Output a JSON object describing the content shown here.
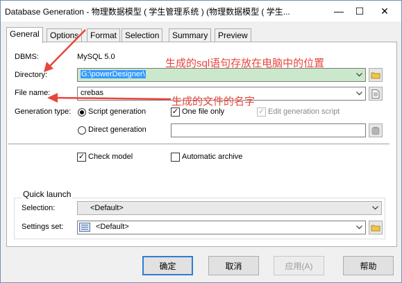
{
  "window": {
    "title": "Database Generation - 物理数据模型 ( 学生管理系统 ) (物理数据模型 ( 学生...",
    "minimize_glyph": "—",
    "maximize_glyph": "☐",
    "close_glyph": "✕"
  },
  "tabs": [
    "General",
    "Options",
    "Format",
    "Selection",
    "Summary",
    "Preview"
  ],
  "general": {
    "dbms_label": "DBMS:",
    "dbms_value": "MySQL 5.0",
    "directory_label": "Directory:",
    "directory_value": "G:\\powerDesigner\\",
    "filename_label": "File name:",
    "filename_value": "crebas",
    "generation_type_label": "Generation type:",
    "script_generation": "Script generation",
    "direct_generation": "Direct generation",
    "one_file_only": "One file only",
    "edit_generation_script": "Edit generation script",
    "check_model": "Check model",
    "automatic_archive": "Automatic archive"
  },
  "quick_launch": {
    "title": "Quick launch",
    "selection_label": "Selection:",
    "selection_value": "<Default>",
    "settings_label": "Settings set:",
    "settings_value": "<Default>"
  },
  "buttons": {
    "ok": "确定",
    "cancel": "取消",
    "apply": "应用(A)",
    "help": "帮助"
  },
  "annotations": {
    "directory_note": "生成的sql语句存放在电脑中的位置",
    "filename_note": "生成的文件的名字"
  },
  "colors": {
    "annotation_red": "#e8453c",
    "selection_blue": "#3399ff",
    "default_button_border": "#2f7bd6"
  }
}
